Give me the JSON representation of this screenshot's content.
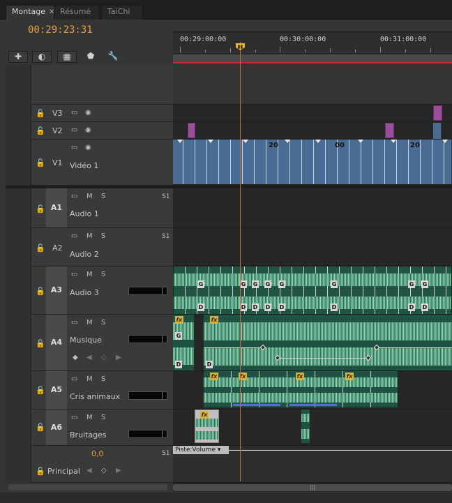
{
  "tabs": [
    {
      "label": "Montage",
      "close": "✕",
      "active": true
    },
    {
      "label": "Résumé",
      "active": false
    },
    {
      "label": "TaiChi",
      "active": false
    }
  ],
  "timecode": "00:29:23:31",
  "toolbar": {
    "snap_icon": "snap-icon",
    "link_icon": "link-icon",
    "marker_add_icon": "add-marker-icon",
    "marker_icon": "marker-icon",
    "settings_icon": "wrench-icon"
  },
  "ruler": {
    "labels": [
      "00:29:00:00",
      "00:30:00:00",
      "00:31:00:00"
    ]
  },
  "video_tracks": [
    {
      "id": "V3",
      "name": ""
    },
    {
      "id": "V2",
      "name": ""
    },
    {
      "id": "V1",
      "name": "Vidéo 1"
    }
  ],
  "audio_tracks": [
    {
      "id": "A1",
      "name": "Audio 1",
      "badge": "S1",
      "mute": "M",
      "solo": "S"
    },
    {
      "id": "A2",
      "name": "Audio 2",
      "badge": "S1",
      "mute": "M",
      "solo": "S"
    },
    {
      "id": "A3",
      "name": "Audio 3",
      "mute": "M",
      "solo": "S"
    },
    {
      "id": "A4",
      "name": "Musique",
      "mute": "M",
      "solo": "S"
    },
    {
      "id": "A5",
      "name": "Cris animaux",
      "mute": "M",
      "solo": "S"
    },
    {
      "id": "A6",
      "name": "Bruitages",
      "mute": "M",
      "solo": "S"
    }
  ],
  "master": {
    "name": "Principal",
    "value": "0,0",
    "badge": "S1",
    "clip_label": "Piste:Volume ▾"
  },
  "clip_text": {
    "v1_num_1": "20",
    "v1_num_2": "00",
    "v1_num_3": "20",
    "g": "G",
    "d": "D",
    "fx": "fx"
  },
  "colors": {
    "accent": "#e6a23c",
    "playhead": "#d2633e",
    "video_clip": "#4a6c93",
    "audio_clip": "#1f5542",
    "adjust_clip": "#9a4f9c"
  }
}
